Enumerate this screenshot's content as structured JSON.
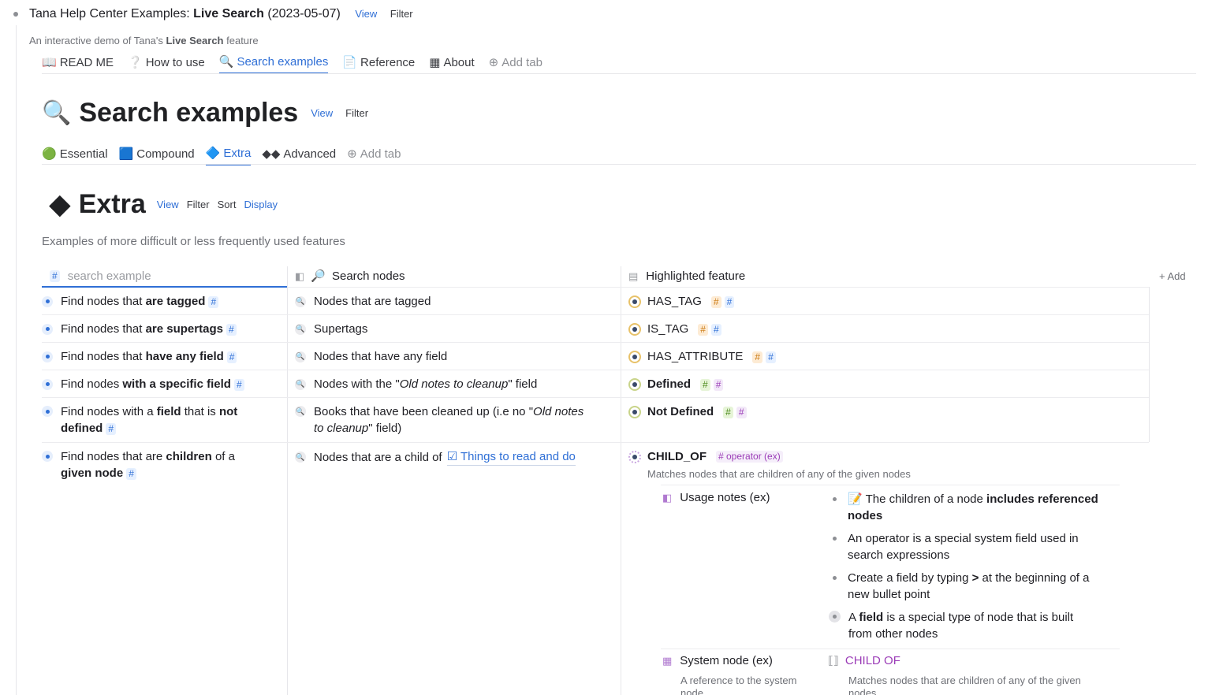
{
  "root": {
    "title_prefix": "Tana Help Center Examples: ",
    "title_bold": "Live Search",
    "title_suffix": " (2023-05-07)",
    "view": "View",
    "filter": "Filter",
    "desc_prefix": "An interactive demo of Tana's ",
    "desc_bold": "Live Search",
    "desc_suffix": " feature"
  },
  "tabs": [
    {
      "icon": "📖",
      "label": "READ ME"
    },
    {
      "icon": "❔",
      "label": "How to use"
    },
    {
      "icon": "🔍",
      "label": "Search examples"
    },
    {
      "icon": "📄",
      "label": "Reference"
    },
    {
      "icon": "▦",
      "label": "About"
    },
    {
      "icon": "⊕",
      "label": "Add tab"
    }
  ],
  "search_examples": {
    "icon": "🔍",
    "title": "Search examples",
    "view": "View",
    "filter": "Filter",
    "tabs": [
      {
        "icon": "🟢",
        "label": "Essential"
      },
      {
        "icon": "🟦",
        "label": "Compound"
      },
      {
        "icon": "🔷",
        "label": "Extra"
      },
      {
        "icon": "◆◆",
        "label": "Advanced"
      },
      {
        "icon": "⊕",
        "label": "Add tab"
      }
    ]
  },
  "extra": {
    "icon": "◆",
    "title": "Extra",
    "view": "View",
    "filter": "Filter",
    "sort": "Sort",
    "display": "Display",
    "description": "Examples of more difficult or less frequently used features"
  },
  "table": {
    "col1_placeholder": "search example",
    "col1_hash": "#",
    "col2_header": "Search nodes",
    "col3_header": "Highlighted feature",
    "add": "+ Add",
    "rows": [
      {
        "c1a": "Find nodes that ",
        "c1b": "are tagged",
        "c1c": "",
        "c2": "Nodes that are tagged",
        "c3": "HAS_TAG"
      },
      {
        "c1a": "Find nodes that ",
        "c1b": "are supertags",
        "c1c": "",
        "c2": "Supertags",
        "c3": "IS_TAG"
      },
      {
        "c1a": "Find nodes that ",
        "c1b": "have any field",
        "c1c": "",
        "c2": "Nodes that have any field",
        "c3": "HAS_ATTRIBUTE"
      },
      {
        "c1a": "Find nodes ",
        "c1b": "with a specific field",
        "c1c": "",
        "c2a": "Nodes with the \"",
        "c2b": "Old notes to cleanup",
        "c2c": "\" field",
        "c3": "Defined"
      },
      {
        "c1a": "Find nodes with a ",
        "c1b": "field",
        "c1c": " that is ",
        "c1d": "not",
        "c1e": "defined",
        "c2a": "Books that have been cleaned up (i.e no \"",
        "c2b": "Old notes",
        "c2c": "to cleanup",
        "c2d": "\" field)",
        "c3": "Not Defined"
      },
      {
        "c1a": "Find nodes that are ",
        "c1b": "children",
        "c1c": " of a",
        "c1d": "given node",
        "c2a": "Nodes that are a child of ",
        "c2ref": "Things to read and do",
        "c3": "CHILD_OF",
        "c3tag": "# operator (ex)",
        "c3desc": "Matches nodes that are children of any of the given nodes"
      }
    ],
    "tag_hash": "#"
  },
  "child_of": {
    "usage_label": "Usage notes (ex)",
    "notes": [
      {
        "pre": "The children of a node ",
        "bold": "includes referenced",
        "post": "",
        "line2": "nodes"
      },
      {
        "line1": "An operator is a special system field used in",
        "line2": "search expressions"
      },
      {
        "line1a": "Create a field by typing ",
        "line1b": ">",
        "line1c": " at the beginning of a",
        "line2": "new bullet point"
      },
      {
        "line1a": "A ",
        "line1b": "field",
        "line1c": " is a special type of node that is built",
        "line2": "from other nodes"
      }
    ],
    "system_label": "System node (ex)",
    "system_desc": "A reference to the system",
    "system_desc2": "node",
    "system_value": "CHILD OF",
    "system_value_desc": "Matches nodes that are children of any of the given",
    "system_value_desc2": "nodes"
  },
  "colors": {
    "accent": "#2f6fd6",
    "text": "#1f1f24",
    "muted": "#6f7177"
  }
}
